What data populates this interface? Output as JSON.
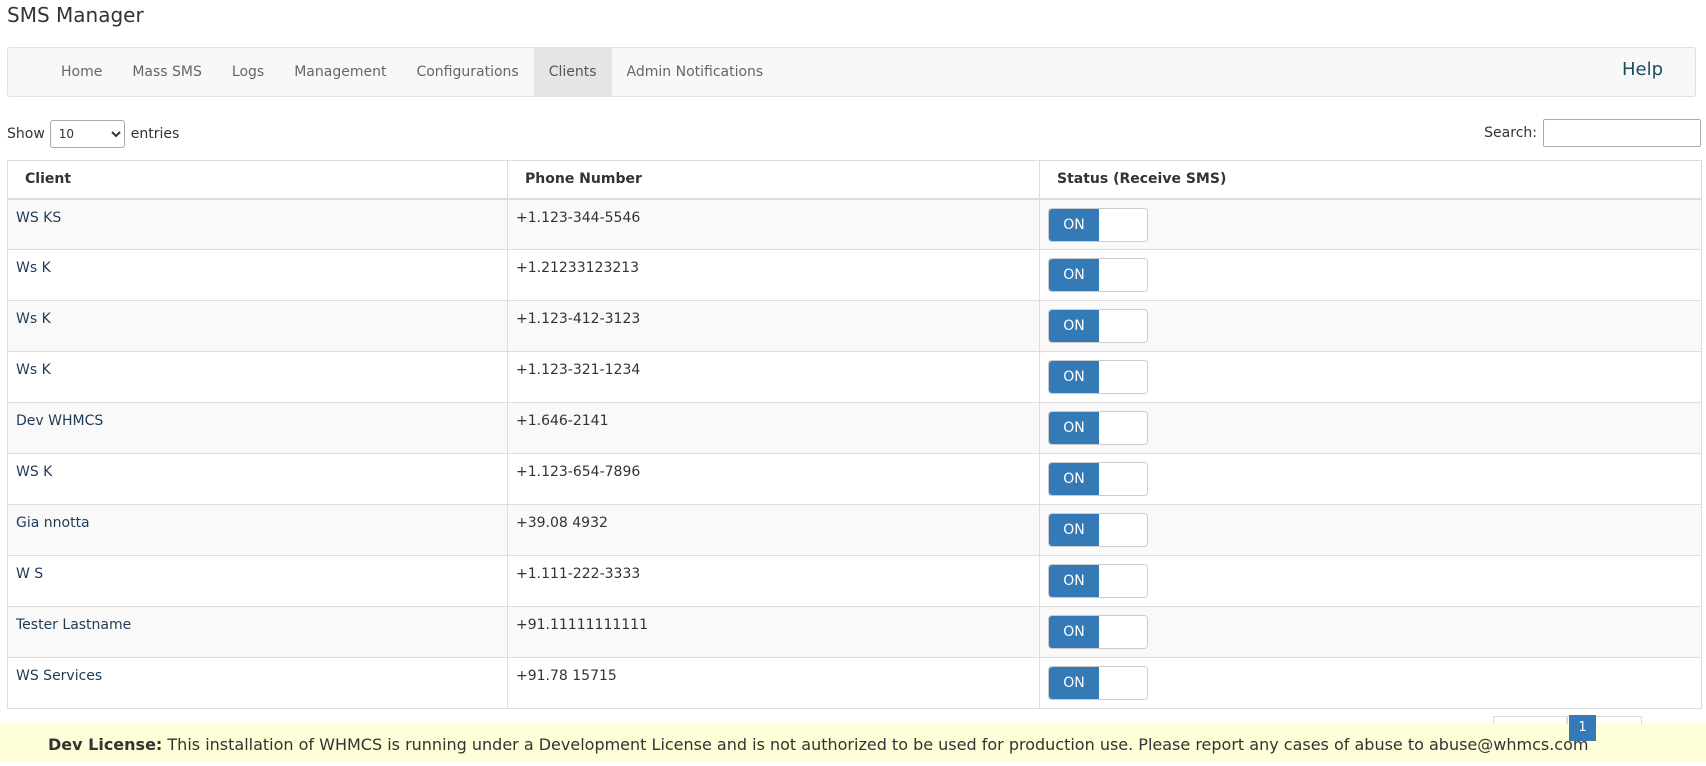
{
  "app_title": "SMS Manager",
  "nav": {
    "items": [
      {
        "label": "Home"
      },
      {
        "label": "Mass SMS"
      },
      {
        "label": "Logs"
      },
      {
        "label": "Management"
      },
      {
        "label": "Configurations"
      },
      {
        "label": "Clients",
        "active": true
      },
      {
        "label": "Admin Notifications"
      }
    ],
    "help_label": "Help"
  },
  "length": {
    "show_label": "Show",
    "selected": "10",
    "entries_label": "entries"
  },
  "search": {
    "label": "Search:",
    "value": ""
  },
  "table": {
    "columns": [
      "Client",
      "Phone Number",
      "Status (Receive SMS)"
    ],
    "rows": [
      {
        "client": "WS KS",
        "phone": "+1.123-344-5546",
        "status": "ON"
      },
      {
        "client": "Ws K",
        "phone": "+1.21233123213",
        "status": "ON"
      },
      {
        "client": "Ws K",
        "phone": "+1.123-412-3123",
        "status": "ON"
      },
      {
        "client": "Ws K",
        "phone": "+1.123-321-1234",
        "status": "ON"
      },
      {
        "client": "Dev WHMCS",
        "phone": "+1.646-2141",
        "status": "ON"
      },
      {
        "client": "WS K",
        "phone": "+1.123-654-7896",
        "status": "ON"
      },
      {
        "client": "Gia nnotta",
        "phone": "+39.08 4932",
        "status": "ON"
      },
      {
        "client": "W S",
        "phone": "+1.111-222-3333",
        "status": "ON"
      },
      {
        "client": "Tester Lastname",
        "phone": "+91.11111111111",
        "status": "ON"
      },
      {
        "client": "WS Services",
        "phone": "+91.78 15715",
        "status": "ON"
      }
    ]
  },
  "pagination": {
    "current_page": "1"
  },
  "footer": {
    "label": "Dev License:",
    "text": "This installation of WHMCS is running under a Development License and is not authorized to be used for production use. Please report any cases of abuse to abuse@whmcs.com"
  },
  "colors": {
    "accent": "#337ab7",
    "footer_bg": "#fefed8",
    "nav_bg": "#f8f8f8"
  }
}
